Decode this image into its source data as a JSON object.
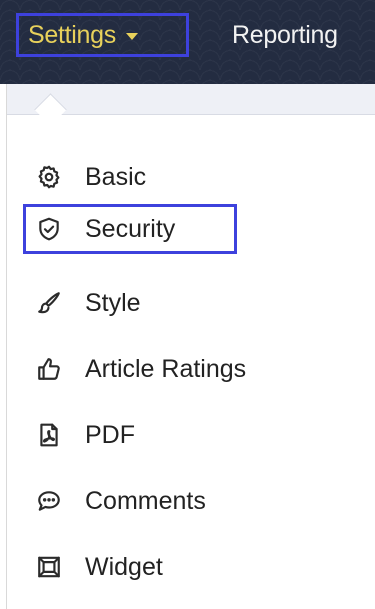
{
  "nav": {
    "settings_label": "Settings",
    "reporting_label": "Reporting"
  },
  "menu": {
    "items": [
      {
        "label": "Basic",
        "icon": "gear-icon"
      },
      {
        "label": "Security",
        "icon": "shield-icon"
      },
      {
        "label": "Style",
        "icon": "brush-icon"
      },
      {
        "label": "Article Ratings",
        "icon": "thumbs-up-icon"
      },
      {
        "label": "PDF",
        "icon": "pdf-icon"
      },
      {
        "label": "Comments",
        "icon": "comment-icon"
      },
      {
        "label": "Widget",
        "icon": "widget-icon"
      }
    ]
  },
  "colors": {
    "nav_bg": "#232c41",
    "settings_text": "#e8d15b",
    "highlight_border": "#3d41dd"
  }
}
